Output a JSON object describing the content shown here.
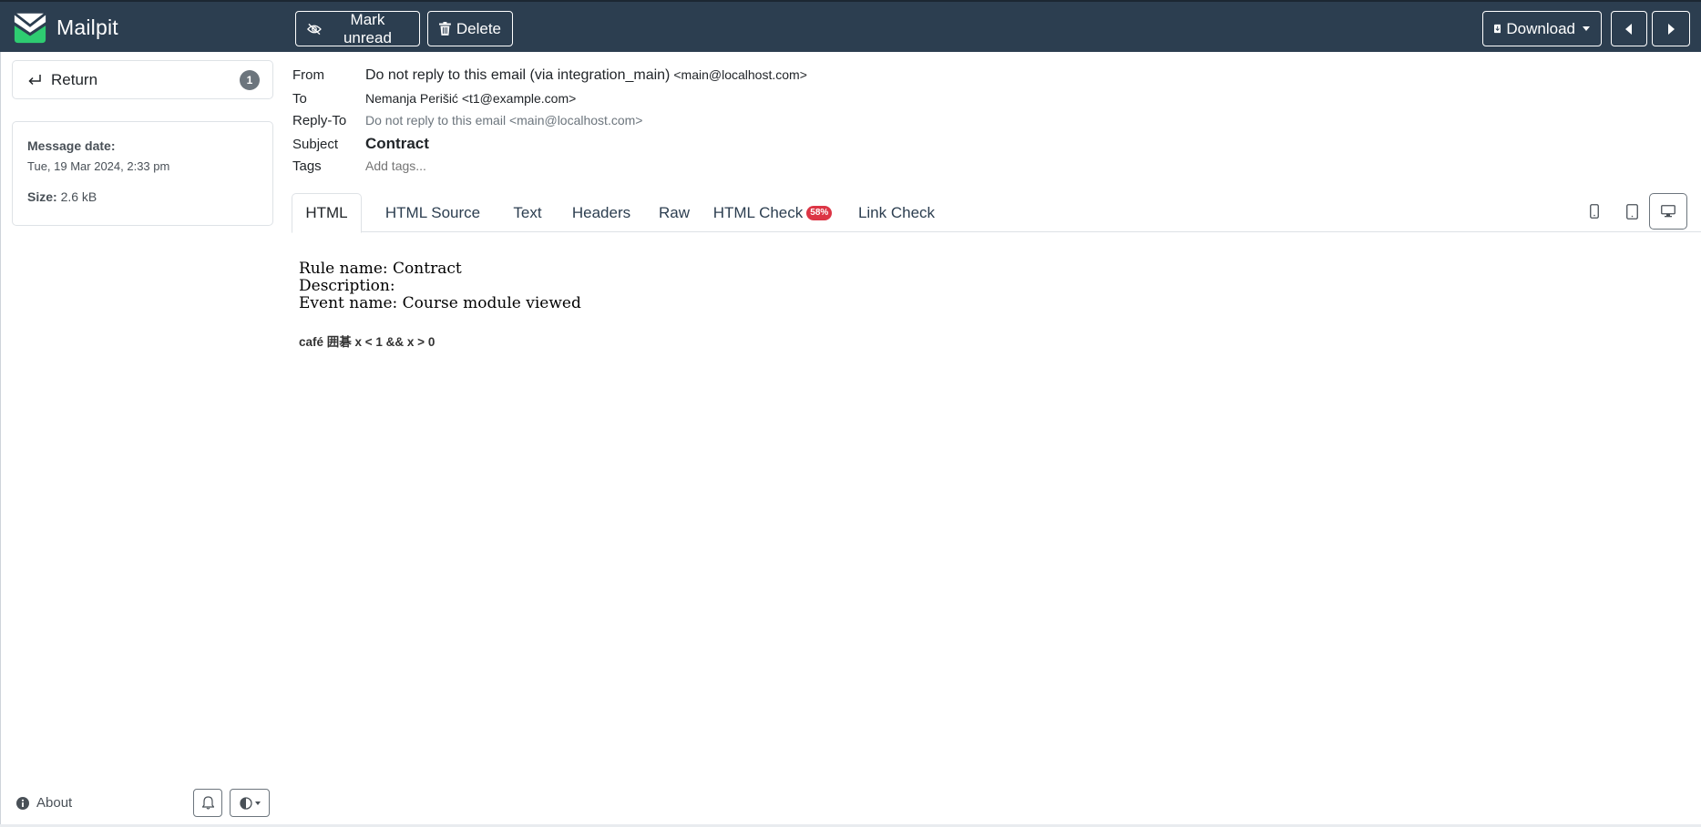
{
  "app": {
    "name": "Mailpit"
  },
  "toolbar": {
    "mark_unread_label": "Mark unread",
    "delete_label": "Delete",
    "download_label": "Download",
    "prev_icon": "caret-left-icon",
    "next_icon": "caret-right-icon"
  },
  "sidebar": {
    "return_label": "Return",
    "return_badge": "1",
    "message_date_label": "Message date:",
    "message_date_value": "Tue, 19 Mar 2024, 2:33 pm",
    "size_label": "Size:",
    "size_value": "2.6 kB",
    "about_label": "About"
  },
  "message": {
    "from_label": "From",
    "from_name": "Do not reply to this email (via integration_main)",
    "from_email": "<main@localhost.com>",
    "to_label": "To",
    "to_value": "Nemanja Perišić <t1@example.com>",
    "reply_to_label": "Reply-To",
    "reply_to_value": "Do not reply to this email <main@localhost.com>",
    "subject_label": "Subject",
    "subject_value": "Contract",
    "tags_label": "Tags",
    "tags_placeholder": "Add tags..."
  },
  "tabs": [
    {
      "label": "HTML",
      "active": true
    },
    {
      "label": "HTML Source"
    },
    {
      "label": "Text"
    },
    {
      "label": "Headers"
    },
    {
      "label": "Raw"
    },
    {
      "label": "HTML Check",
      "badge": "58%"
    },
    {
      "label": "Link Check"
    }
  ],
  "body": {
    "lines": [
      "Rule name: Contract",
      "Description:",
      "Event name: Course module viewed"
    ],
    "footer": "café 囲碁 x < 1 && x > 0"
  },
  "colors": {
    "navbar": "#2c3e50",
    "badge_danger": "#dc3545",
    "badge_secondary": "#6c757d",
    "brand_accent": "#2ecc71"
  }
}
